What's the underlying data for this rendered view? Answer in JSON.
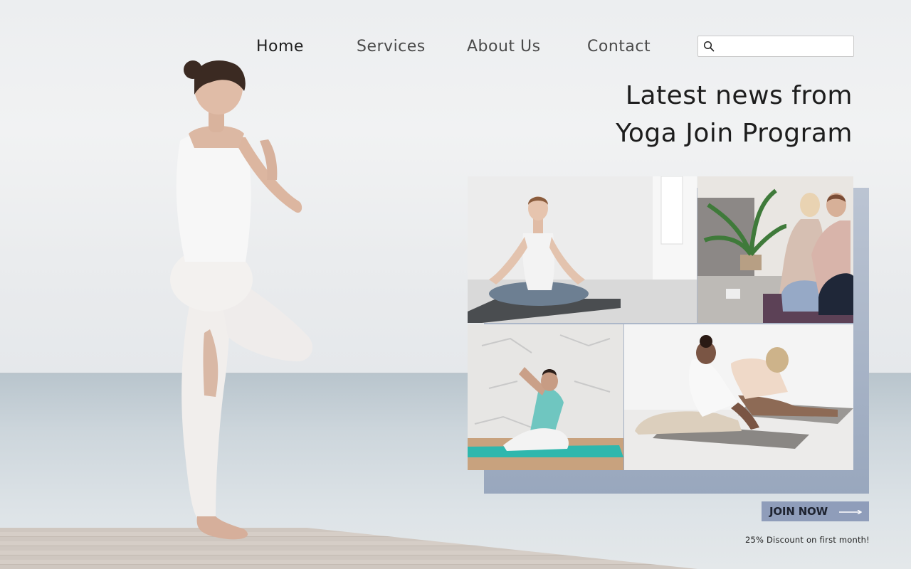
{
  "nav": {
    "items": [
      {
        "label": "Home",
        "active": true
      },
      {
        "label": "Services",
        "active": false
      },
      {
        "label": "About Us",
        "active": false
      },
      {
        "label": "Contact",
        "active": false
      }
    ],
    "search": {
      "placeholder": "",
      "value": "",
      "icon": "search-icon"
    }
  },
  "headline": {
    "line1": "Latest news from",
    "line2": "Yoga Join Program"
  },
  "gallery": {
    "photos": [
      {
        "subject": "woman meditating in lotus pose on grey mat"
      },
      {
        "subject": "two women kneeling in prayer pose near potted palm"
      },
      {
        "subject": "woman in lunge twist on teal mat by white brick wall"
      },
      {
        "subject": "two women in seated forward bend on grey mats"
      }
    ]
  },
  "cta": {
    "button_label": "JOIN NOW",
    "discount_text": "25% Discount on first month!"
  },
  "colors": {
    "accent": "#8f9dba",
    "text_dark": "#1d1d1d",
    "nav_text": "#4a4a4a"
  }
}
